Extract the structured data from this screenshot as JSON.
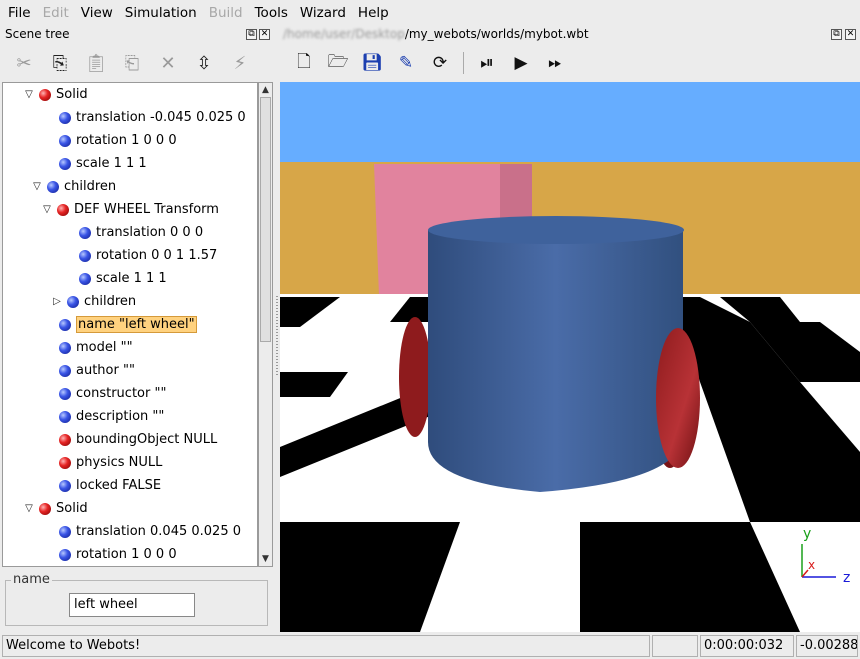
{
  "menu": [
    "File",
    "Edit",
    "View",
    "Simulation",
    "Build",
    "Tools",
    "Wizard",
    "Help"
  ],
  "menu_disabled": [
    "Edit",
    "Build"
  ],
  "scene_tree": {
    "title": "Scene tree",
    "toolbar_icons": [
      "cut-icon",
      "copy-icon",
      "paste-icon",
      "paste-after-icon",
      "delete-icon",
      "reset-value-icon",
      "transform-icon"
    ],
    "rows": [
      {
        "label": "Solid",
        "ball": "red",
        "arrow": "down"
      },
      {
        "label": "translation -0.045 0.025 0",
        "ball": "blue",
        "arrow": ""
      },
      {
        "label": "rotation 1 0 0 0",
        "ball": "blue",
        "arrow": ""
      },
      {
        "label": "scale 1 1 1",
        "ball": "blue",
        "arrow": ""
      },
      {
        "label": "children",
        "ball": "blue",
        "arrow": "down"
      },
      {
        "label": "DEF WHEEL Transform",
        "ball": "red",
        "arrow": "down"
      },
      {
        "label": "translation 0 0 0",
        "ball": "blue",
        "arrow": ""
      },
      {
        "label": "rotation 0 0 1 1.57",
        "ball": "blue",
        "arrow": ""
      },
      {
        "label": "scale 1 1 1",
        "ball": "blue",
        "arrow": ""
      },
      {
        "label": "children",
        "ball": "blue",
        "arrow": "right"
      },
      {
        "label": "name \"left wheel\"",
        "ball": "blue",
        "arrow": "",
        "selected": true
      },
      {
        "label": "model \"\"",
        "ball": "blue",
        "arrow": ""
      },
      {
        "label": "author \"\"",
        "ball": "blue",
        "arrow": ""
      },
      {
        "label": "constructor \"\"",
        "ball": "blue",
        "arrow": ""
      },
      {
        "label": "description \"\"",
        "ball": "blue",
        "arrow": ""
      },
      {
        "label": "boundingObject NULL",
        "ball": "red",
        "arrow": ""
      },
      {
        "label": "physics NULL",
        "ball": "red",
        "arrow": ""
      },
      {
        "label": "locked FALSE",
        "ball": "blue",
        "arrow": ""
      },
      {
        "label": "Solid",
        "ball": "red",
        "arrow": "down"
      },
      {
        "label": "translation 0.045 0.025 0",
        "ball": "blue",
        "arrow": ""
      },
      {
        "label": "rotation 1 0 0 0",
        "ball": "blue",
        "arrow": ""
      }
    ],
    "field_editor": {
      "legend": "name",
      "value": "left wheel"
    }
  },
  "view": {
    "path_blurred": "/home/user/Desktop",
    "path": "/my_webots/worlds/mybot.wbt",
    "toolbar_icons": [
      "new-world-icon",
      "open-world-icon",
      "save-world-icon",
      "save-as-icon",
      "revert-icon",
      "step-icon",
      "run-icon",
      "fast-icon"
    ],
    "axes": {
      "y": "y",
      "x": "x",
      "z": "z"
    }
  },
  "status": {
    "message": "Welcome to Webots!",
    "time": "0:00:00:032",
    "value": "-0.00288"
  },
  "colors": {
    "sky": "#66adff",
    "wall": "#d7a648",
    "pink_box": "#e1839e",
    "robot_body": "#3c5f99",
    "wheel": "#a8282b",
    "floor_dark": "#000000",
    "floor_light": "#ffffff"
  }
}
